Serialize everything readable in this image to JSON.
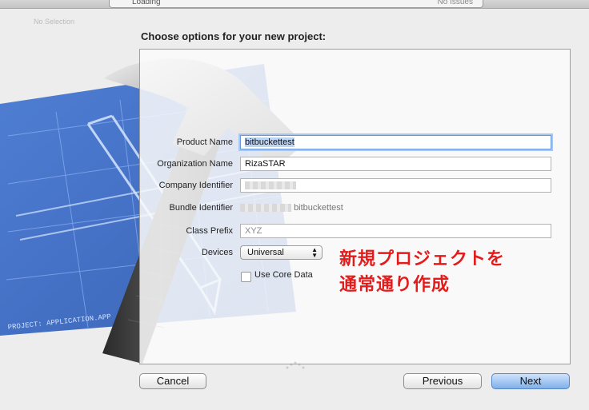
{
  "window": {
    "status_left": "Loading",
    "status_right": "No Issues",
    "no_selection": "No Selection"
  },
  "sheet": {
    "heading": "Choose options for your new project:"
  },
  "form": {
    "product_name": {
      "label": "Product Name",
      "value": "bitbuckettest"
    },
    "organization_name": {
      "label": "Organization Name",
      "value": "RizaSTAR"
    },
    "company_identifier": {
      "label": "Company Identifier"
    },
    "bundle_identifier": {
      "label": "Bundle Identifier",
      "value_suffix": "bitbuckettest"
    },
    "class_prefix": {
      "label": "Class Prefix",
      "placeholder": "XYZ"
    },
    "devices": {
      "label": "Devices",
      "selected": "Universal"
    },
    "use_core_data": {
      "label": "Use Core Data",
      "checked": false
    }
  },
  "annotation": {
    "line1": "新規プロジェクトを",
    "line2": "通常通り作成",
    "color": "#e31b1b"
  },
  "buttons": {
    "cancel": "Cancel",
    "previous": "Previous",
    "next": "Next"
  },
  "art": {
    "blueprint_text": "PROJECT: APPLICATION.APP"
  }
}
